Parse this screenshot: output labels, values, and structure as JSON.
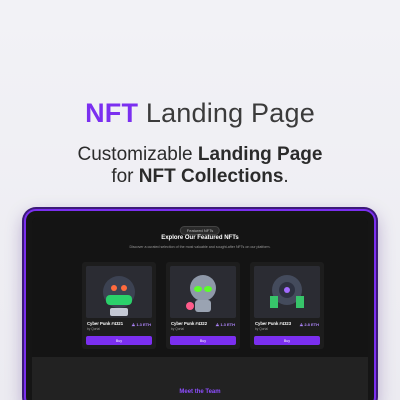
{
  "hero": {
    "title_accent": "NFT",
    "title_rest": " Landing Page",
    "sub1_normal": "Customizable ",
    "sub1_bold": "Landing Page",
    "sub2_normal": "for ",
    "sub2_bold": "NFT Collections",
    "sub2_end": "."
  },
  "featured": {
    "pill": "Featured NFTs",
    "title": "Explore Our Featured NFTs",
    "description": "Discover a curated selection of the most valuable and sought-after NFTs on our platform."
  },
  "cards": [
    {
      "name": "Cyber Punk #4321",
      "by": "by Qortal",
      "price": "1.3 ETH",
      "buy": "Buy"
    },
    {
      "name": "Cyber Punk #4322",
      "by": "by Qortal",
      "price": "1.3 ETH",
      "buy": "Buy"
    },
    {
      "name": "Cyber Punk #4323",
      "by": "by Qortal",
      "price": "2.8 ETH",
      "buy": "Buy"
    }
  ],
  "team": {
    "title": "Meet the Team"
  },
  "colors": {
    "accent": "#7b2ff0",
    "dark": "#121212"
  }
}
